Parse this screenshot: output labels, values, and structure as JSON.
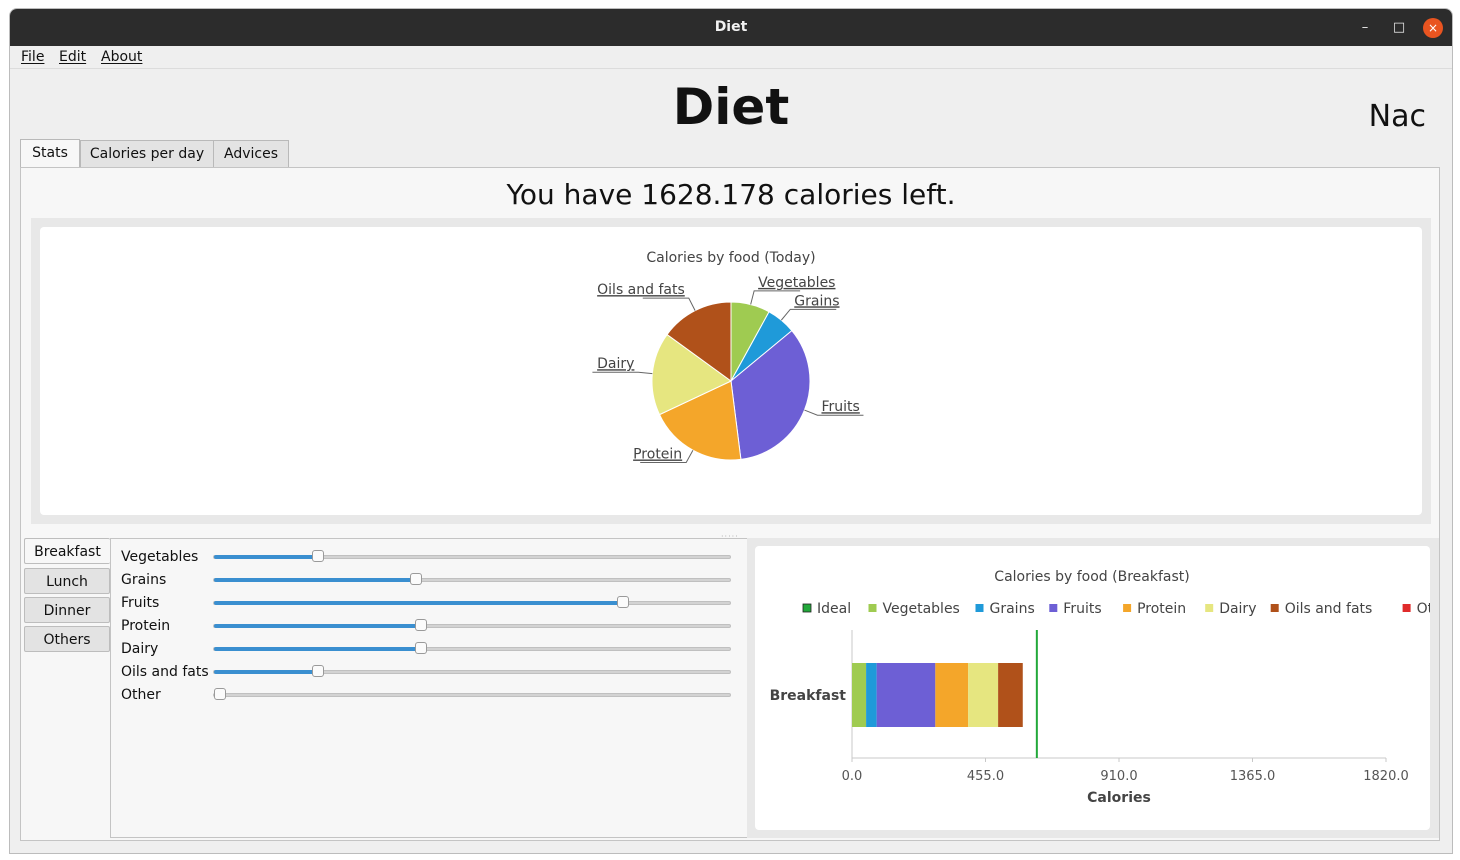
{
  "window": {
    "title": "Diet",
    "minimize_glyph": "–",
    "maximize_glyph": "□",
    "close_glyph": "×"
  },
  "menu": {
    "items": [
      "File",
      "Edit",
      "About"
    ]
  },
  "app": {
    "title": "Diet",
    "user": "Nac"
  },
  "tabs": [
    "Stats",
    "Calories per day",
    "Advices"
  ],
  "stats": {
    "calories_left_text": "You have 1628.178 calories left."
  },
  "meal_tabs": [
    "Breakfast",
    "Lunch",
    "Dinner",
    "Others"
  ],
  "sliders": [
    {
      "label": "Vegetables",
      "value": 0.2
    },
    {
      "label": "Grains",
      "value": 0.39
    },
    {
      "label": "Fruits",
      "value": 0.79
    },
    {
      "label": "Protein",
      "value": 0.4
    },
    {
      "label": "Dairy",
      "value": 0.4
    },
    {
      "label": "Oils and fats",
      "value": 0.2
    },
    {
      "label": "Other",
      "value": 0.0
    }
  ],
  "colors": {
    "Ideal": "#22a83a",
    "Vegetables": "#9fcb51",
    "Grains": "#1f9ad9",
    "Fruits": "#6d5fd5",
    "Protein": "#f4a62a",
    "Dairy": "#e6e680",
    "Oils and fats": "#b0511a",
    "Other": "#e02b2b"
  },
  "chart_data": [
    {
      "type": "pie",
      "title": "Calories by food (Today)",
      "labels": [
        "Vegetables",
        "Grains",
        "Fruits",
        "Protein",
        "Dairy",
        "Oils and fats"
      ],
      "values": [
        8,
        6,
        34,
        20,
        17,
        15
      ]
    },
    {
      "type": "bar",
      "orientation": "horizontal",
      "stacked": true,
      "title": "Calories by food (Breakfast)",
      "legend": [
        "Ideal",
        "Vegetables",
        "Grains",
        "Fruits",
        "Protein",
        "Dairy",
        "Oils and fats",
        "Other"
      ],
      "legend_placement": "top",
      "categories": [
        "Breakfast"
      ],
      "series": [
        {
          "name": "Vegetables",
          "values": [
            48
          ]
        },
        {
          "name": "Grains",
          "values": [
            36
          ]
        },
        {
          "name": "Fruits",
          "values": [
            200
          ]
        },
        {
          "name": "Protein",
          "values": [
            112
          ]
        },
        {
          "name": "Dairy",
          "values": [
            102
          ]
        },
        {
          "name": "Oils and fats",
          "values": [
            84
          ]
        },
        {
          "name": "Other",
          "values": [
            0
          ]
        }
      ],
      "ideal": 630,
      "xlabel": "Calories",
      "xlim": [
        0,
        1820
      ],
      "xticks": [
        "0.0",
        "455.0",
        "910.0",
        "1365.0",
        "1820.0"
      ]
    }
  ]
}
